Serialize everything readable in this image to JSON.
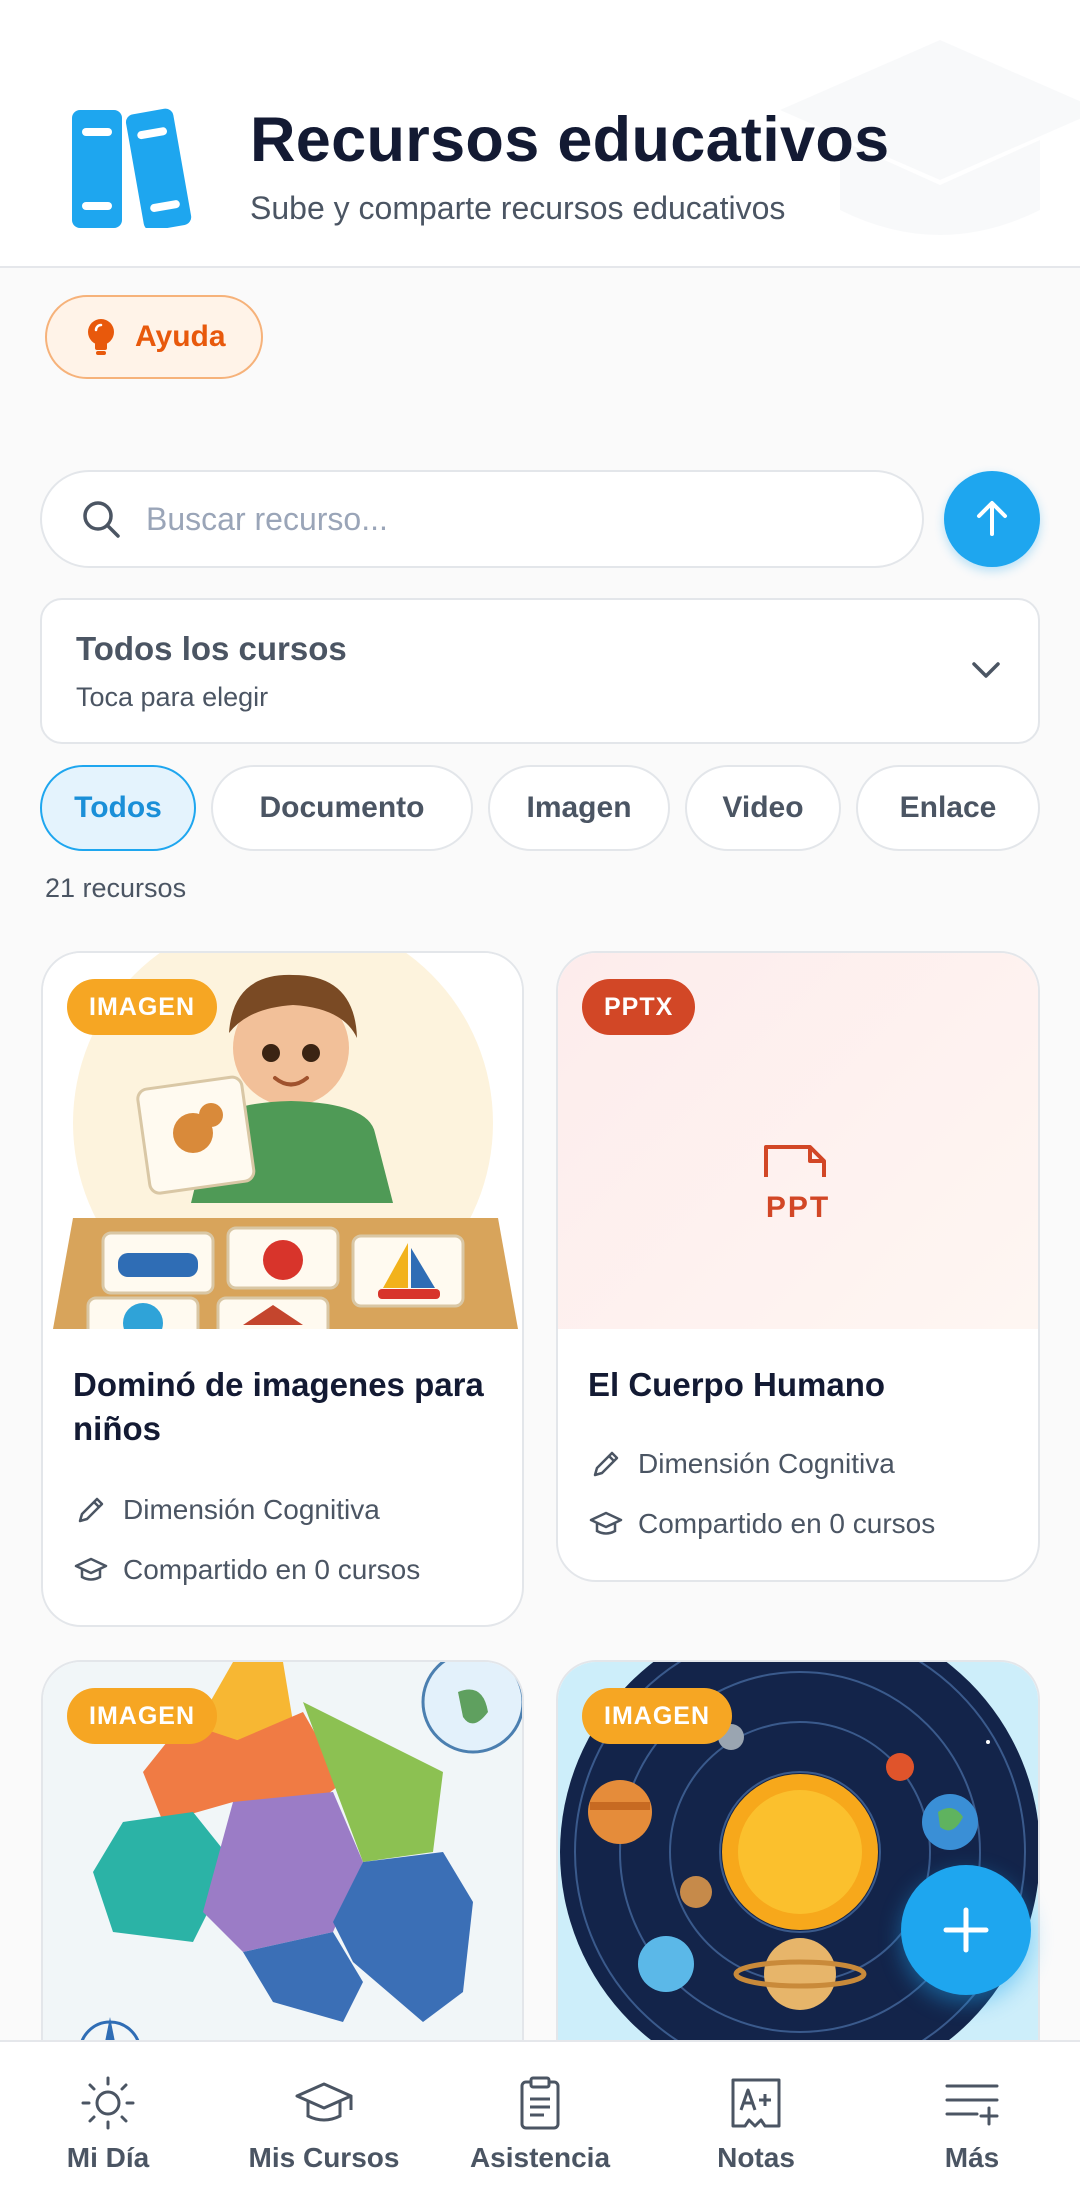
{
  "header": {
    "title": "Recursos educativos",
    "subtitle": "Sube y comparte recursos educativos",
    "logo_icon": "books-icon"
  },
  "help": {
    "label": "Ayuda",
    "icon": "lightbulb-icon"
  },
  "search": {
    "placeholder": "Buscar recurso...",
    "value": ""
  },
  "course_select": {
    "title": "Todos los cursos",
    "hint": "Toca para elegir"
  },
  "filters": {
    "chips": [
      {
        "label": "Todos",
        "active": true
      },
      {
        "label": "Documento",
        "active": false
      },
      {
        "label": "Imagen",
        "active": false
      },
      {
        "label": "Video",
        "active": false
      },
      {
        "label": "Enlace",
        "active": false
      }
    ]
  },
  "results": {
    "count_label": "21 recursos"
  },
  "resources": [
    {
      "badge": "IMAGEN",
      "title": "Dominó de imagenes para niños",
      "dimension": "Dimensión Cognitiva",
      "shared": "Compartido en 0 cursos"
    },
    {
      "badge": "PPTX",
      "file_label": "PPT",
      "title": "El Cuerpo Humano",
      "dimension": "Dimensión Cognitiva",
      "shared": "Compartido en 0 cursos"
    },
    {
      "badge": "IMAGEN"
    },
    {
      "badge": "IMAGEN"
    }
  ],
  "bottom_nav": [
    {
      "label": "Mi Día",
      "icon": "sun-icon"
    },
    {
      "label": "Mis Cursos",
      "icon": "graduation-cap-icon"
    },
    {
      "label": "Asistencia",
      "icon": "clipboard-icon"
    },
    {
      "label": "Notas",
      "icon": "grade-a-plus-icon"
    },
    {
      "label": "Más",
      "icon": "menu-plus-icon"
    }
  ],
  "colors": {
    "primary": "#1ea6ef",
    "help": "#e8590c",
    "badge_image": "#f6a623",
    "badge_pptx": "#d24726"
  }
}
